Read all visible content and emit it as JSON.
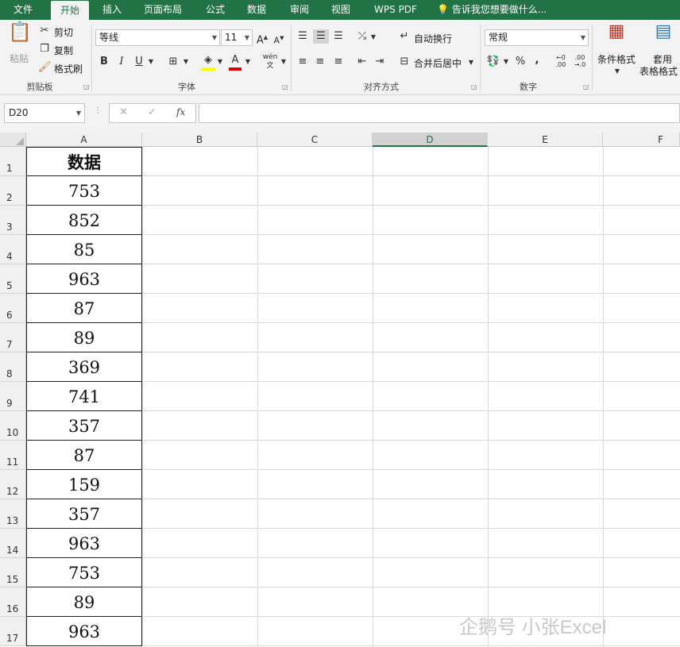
{
  "tabs": [
    {
      "label": "文件",
      "active": false
    },
    {
      "label": "开始",
      "active": true
    },
    {
      "label": "插入",
      "active": false
    },
    {
      "label": "页面布局",
      "active": false
    },
    {
      "label": "公式",
      "active": false
    },
    {
      "label": "数据",
      "active": false
    },
    {
      "label": "审阅",
      "active": false
    },
    {
      "label": "视图",
      "active": false
    },
    {
      "label": "WPS PDF",
      "active": false
    }
  ],
  "tell_me": "告诉我您想要做什么...",
  "ribbon": {
    "clipboard": {
      "paste": "粘贴",
      "cut": "剪切",
      "copy": "复制",
      "format_painter": "格式刷",
      "group": "剪贴板"
    },
    "font": {
      "name": "等线",
      "size": "11",
      "bold": "B",
      "italic": "I",
      "underline": "U",
      "group": "字体"
    },
    "alignment": {
      "wrap": "自动换行",
      "merge": "合并后居中",
      "group": "对齐方式"
    },
    "number": {
      "format": "常规",
      "percent": "%",
      "comma": ",",
      "group": "数字"
    },
    "styles": {
      "conditional": "条件格式",
      "table_line1": "套用",
      "table_line2": "表格格式"
    }
  },
  "formula_bar": {
    "name_box": "D20",
    "cancel": "✕",
    "enter": "✓",
    "fx": "fx",
    "formula": ""
  },
  "columns": [
    "A",
    "B",
    "C",
    "D",
    "E",
    "F"
  ],
  "selected_column": "D",
  "rows": [
    "1",
    "2",
    "3",
    "4",
    "5",
    "6",
    "7",
    "8",
    "9",
    "10",
    "11",
    "12",
    "13",
    "14",
    "15",
    "16",
    "17"
  ],
  "cells_A": [
    "数据",
    "753",
    "852",
    "85",
    "963",
    "87",
    "89",
    "369",
    "741",
    "357",
    "87",
    "159",
    "357",
    "963",
    "753",
    "89",
    "963"
  ],
  "watermark": "企鹅号 小张Excel",
  "colors": {
    "accent": "#217346",
    "ribbon_bg": "#f3f3f3"
  }
}
